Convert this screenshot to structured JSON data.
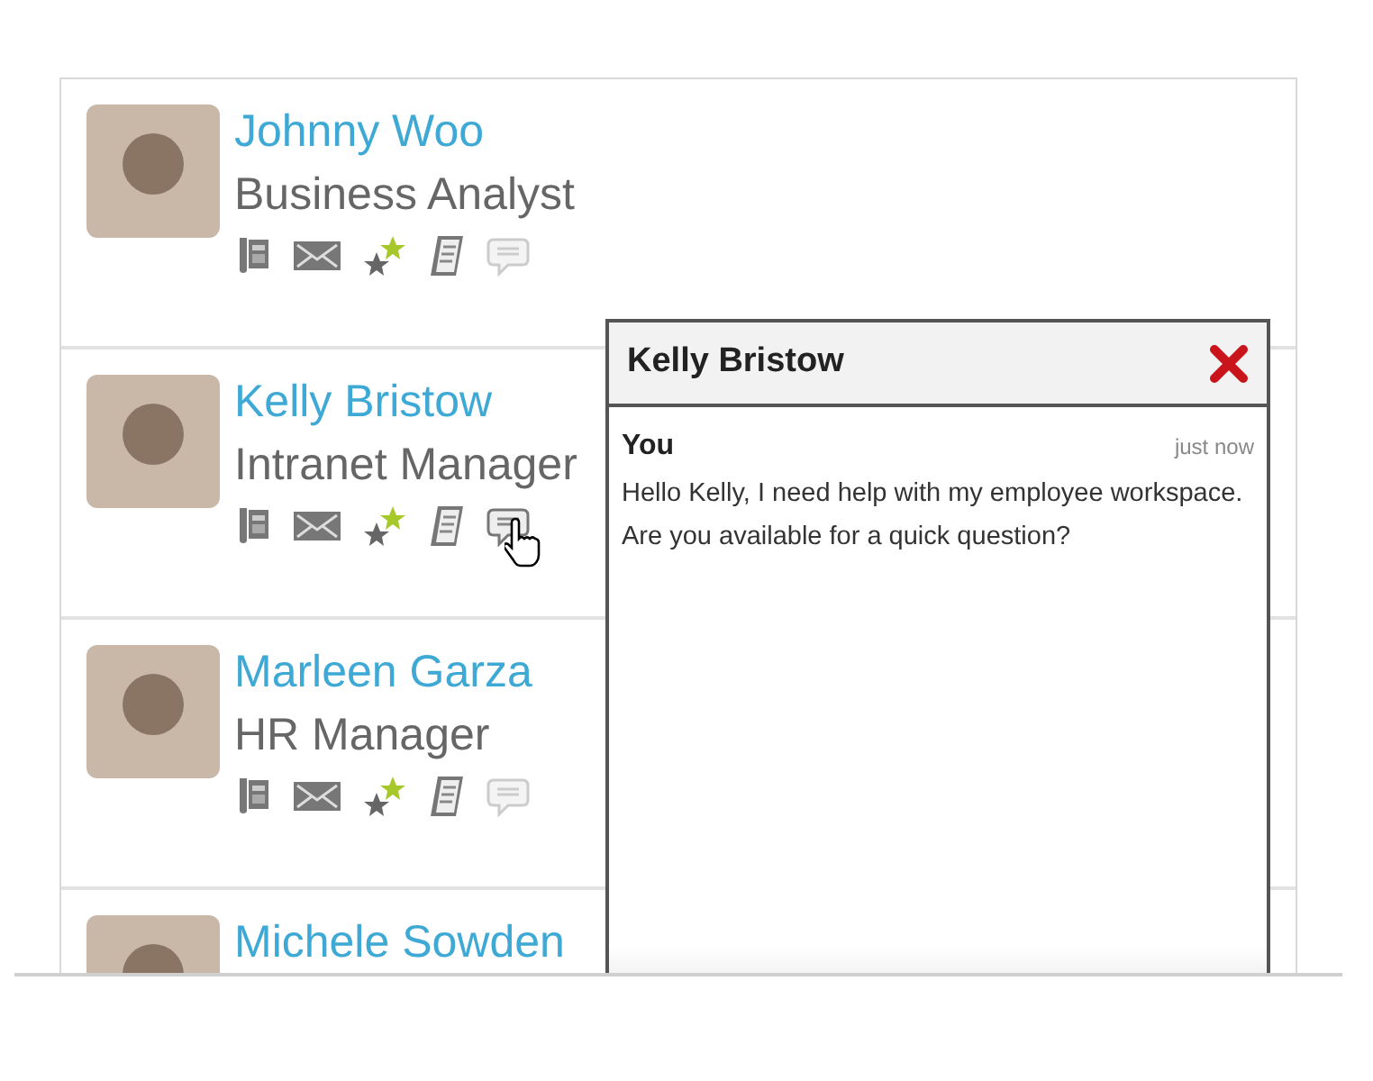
{
  "people": [
    {
      "name": "Johnny Woo",
      "title": "Business Analyst",
      "chat_active": false
    },
    {
      "name": "Kelly Bristow",
      "title": "Intranet Manager",
      "chat_active": true
    },
    {
      "name": "Marleen Garza",
      "title": "HR Manager",
      "chat_active": false
    },
    {
      "name": "Michele Sowden"
    }
  ],
  "chat": {
    "title": "Kelly Bristow",
    "messages": [
      {
        "sender": "You",
        "time": "just now",
        "text": "Hello Kelly, I need help with my employee workspace. Are you available for a quick question?"
      }
    ]
  }
}
